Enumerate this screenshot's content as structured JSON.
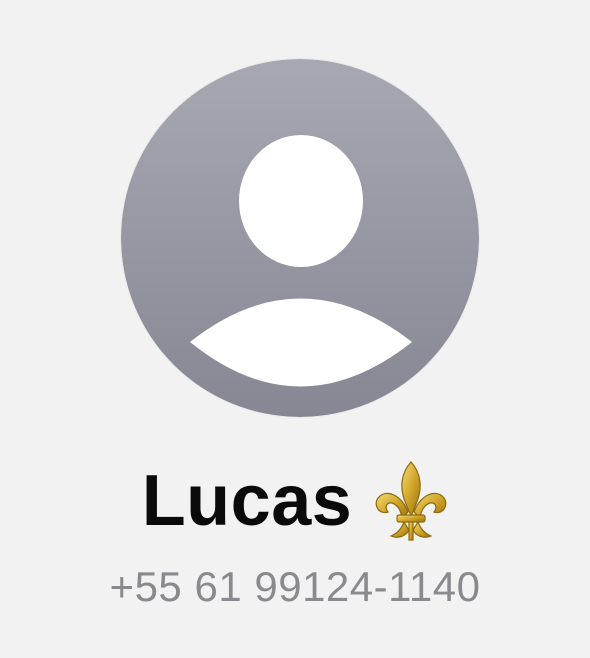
{
  "contact": {
    "avatar_icon": "person-silhouette-icon",
    "name": "Lucas",
    "name_emoji_icon": "fleur-de-lis-icon",
    "phone": "+55 61 99124-1140"
  },
  "colors": {
    "background": "#f2f2f2",
    "avatar_top": "#a5a8b1",
    "avatar_bottom": "#878a95",
    "name": "#0a0a0a",
    "phone": "#8a8a8e",
    "emoji_gold": "#c9a227"
  }
}
